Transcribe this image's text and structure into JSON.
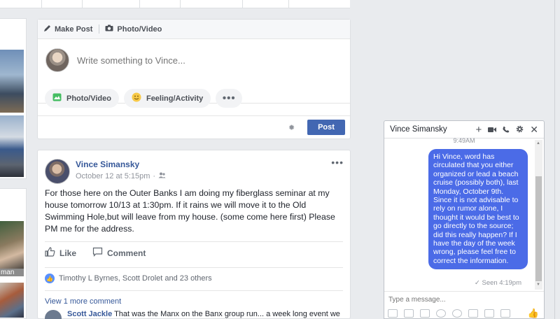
{
  "composer": {
    "tab_make_post": "Make Post",
    "tab_photo_video": "Photo/Video",
    "placeholder": "Write something to Vince...",
    "pill_photo": "Photo/Video",
    "pill_feeling": "Feeling/Activity",
    "more": "•••",
    "post_button": "Post"
  },
  "post": {
    "author": "Vince Simansky",
    "time": "October 12 at 5:15pm",
    "separator": "·",
    "text": "For those here on the Outer Banks I am doing my fiberglass seminar at my house tomorrow 10/13 at 1:30pm. If it rains we will move it to the Old Swimming Hole,but will leave from my house. (some come here first) Please PM me for the address.",
    "like_label": "Like",
    "comment_label": "Comment",
    "reactions": "Timothy L Byrnes, Scott Drolet and 23 others",
    "view_more": "View 1 more comment",
    "comment_author": "Scott Jackle",
    "comment_text": "That was the Manx on the Banx group run... a week long event we"
  },
  "left_photos": {
    "caption": "man"
  },
  "chat": {
    "title": "Vince Simansky",
    "time_top": "9:49AM",
    "message": "Hi Vince, word has circulated that you either organized or lead a beach cruise (possibly both), last Monday, October 9th. Since it is not advisable to rely on rumor alone, I thought it would be best to go directly to the source; did this really happen? If I have the day of the week wrong, please feel free to correct the information.",
    "seen": "Seen 4:19pm",
    "placeholder": "Type a message..."
  },
  "colors": {
    "brand": "#4267b2",
    "bubble": "#4b6be7",
    "link": "#365899"
  }
}
